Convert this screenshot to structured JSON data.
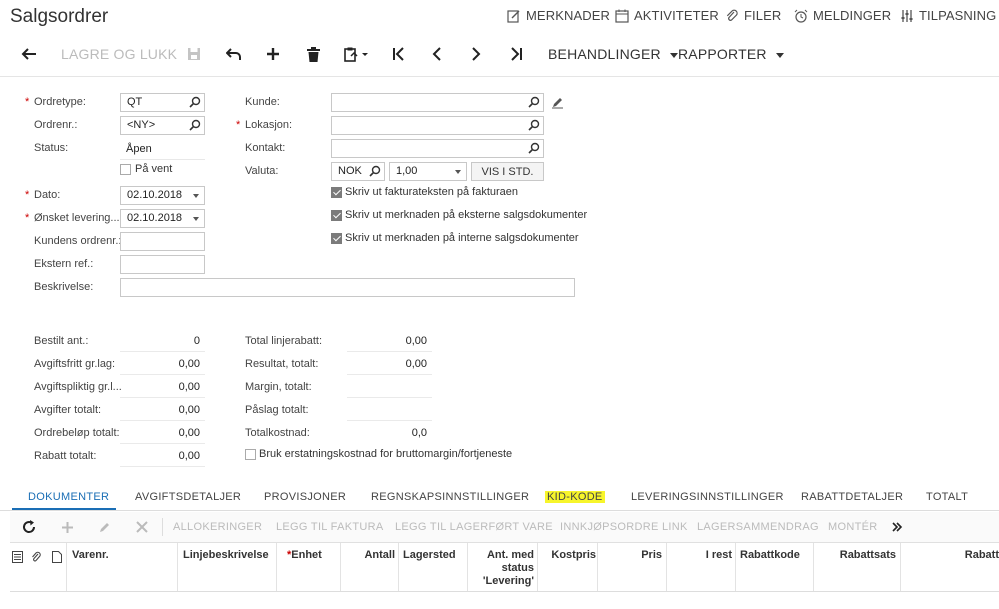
{
  "page": {
    "title": "Salgsordrer"
  },
  "topbar": {
    "notes": "MERKNADER",
    "activities": "AKTIVITETER",
    "files": "FILER",
    "notifications": "MELDINGER",
    "customize": "TILPASNING"
  },
  "toolbar": {
    "save_close": "LAGRE OG LUKK",
    "actions": "BEHANDLINGER",
    "reports": "RAPPORTER"
  },
  "form": {
    "order_type_label": "Ordretype:",
    "order_type_value": "QT",
    "order_nbr_label": "Ordrenr.:",
    "order_nbr_value": "<NY>",
    "status_label": "Status:",
    "status_value": "Åpen",
    "hold_label": "På vent",
    "date_label": "Dato:",
    "date_value": "02.10.2018",
    "requested_label": "Ønsket levering...",
    "requested_value": "02.10.2018",
    "customer_order_label": "Kundens ordrenr.:",
    "external_ref_label": "Ekstern ref.:",
    "description_label": "Beskrivelse:",
    "customer_label": "Kunde:",
    "location_label": "Lokasjon:",
    "contact_label": "Kontakt:",
    "currency_label": "Valuta:",
    "currency_value": "NOK",
    "rate_value": "1,00",
    "view_base_button": "VIS I STD.",
    "check1": "Skriv ut fakturateksten på fakturaen",
    "check2": "Skriv ut merknaden på eksterne salgsdokumenter",
    "check3": "Skriv ut merknaden på interne salgsdokumenter"
  },
  "summary": {
    "ordered_qty_label": "Bestilt ant.:",
    "ordered_qty": "0",
    "tax_exempt_label": "Avgiftsfritt gr.lag:",
    "tax_exempt": "0,00",
    "taxable_label": "Avgiftspliktig gr.l...",
    "taxable": "0,00",
    "tax_total_label": "Avgifter totalt:",
    "tax_total": "0,00",
    "order_total_label": "Ordrebeløp totalt:",
    "order_total": "0,00",
    "discount_total_label": "Rabatt totalt:",
    "discount_total": "0,00",
    "line_discount_label": "Total linjerabatt:",
    "line_discount": "0,00",
    "profit_label": "Resultat, totalt:",
    "profit": "0,00",
    "margin_label": "Margin, totalt:",
    "markup_label": "Påslag totalt:",
    "total_cost_label": "Totalkostnad:",
    "total_cost": "0,0",
    "replacement_cost_label": "Bruk erstatningskostnad for bruttomargin/fortjeneste"
  },
  "tabs": [
    "DOKUMENTER",
    "AVGIFTSDETALJER",
    "PROVISJONER",
    "REGNSKAPSINNSTILLINGER",
    "KID-KODE",
    "LEVERINGSINNSTILLINGER",
    "RABATTDETALJER",
    "TOTALT"
  ],
  "gridbar": {
    "allocations": "ALLOKERINGER",
    "add_invoice": "LEGG TIL FAKTURA",
    "add_stock": "LEGG TIL LAGERFØRT VARE",
    "po_link": "INNKJØPSORDRE LINK",
    "stock_summary": "LAGERSAMMENDRAG",
    "assemble": "MONTÉR"
  },
  "columns": {
    "item": "Varenr.",
    "line_desc": "Linjebeskrivelse",
    "uom": "Enhet",
    "qty": "Antall",
    "warehouse": "Lagersted",
    "qty_ship1": "Ant. med",
    "qty_ship2": "status",
    "qty_ship3": "'Levering'",
    "unit_cost": "Kostpris",
    "price": "Pris",
    "remaining": "I rest",
    "discount_code": "Rabattkode",
    "discount_rate": "Rabattsats",
    "discount": "Rabatt"
  },
  "colors": {
    "accent": "#1a6eb5",
    "highlight": "#f7f52b",
    "required": "#cc0000"
  }
}
